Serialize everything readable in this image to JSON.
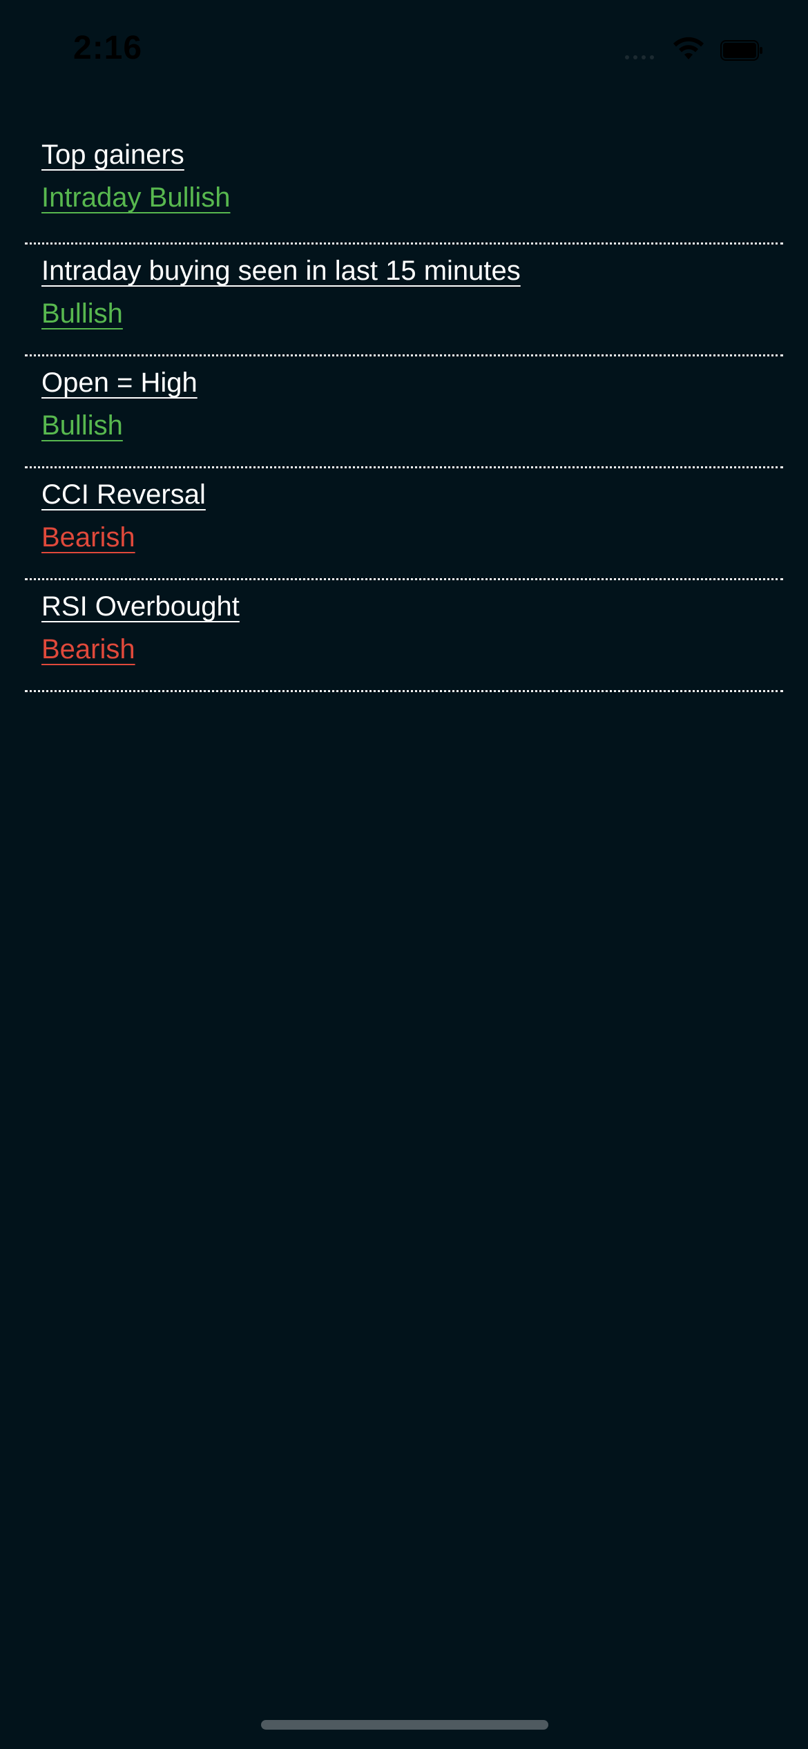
{
  "status_bar": {
    "time": "2:16",
    "icons": [
      "cellular-signal-icon",
      "wifi-icon",
      "battery-icon"
    ]
  },
  "alerts": [
    {
      "name": "Top gainers",
      "signal": "Intraday Bullish",
      "sentiment": "bullish"
    },
    {
      "name": "Intraday buying seen in last 15 minutes",
      "signal": "Bullish",
      "sentiment": "bullish"
    },
    {
      "name": "Open = High",
      "signal": "Bullish",
      "sentiment": "bullish"
    },
    {
      "name": "CCI Reversal",
      "signal": "Bearish",
      "sentiment": "bearish"
    },
    {
      "name": "RSI Overbought",
      "signal": "Bearish",
      "sentiment": "bearish"
    }
  ],
  "colors": {
    "background": "#02131b",
    "bullish": "#58b84f",
    "bearish": "#e0493b",
    "text": "#ffffff",
    "divider": "#f2f2f2"
  }
}
